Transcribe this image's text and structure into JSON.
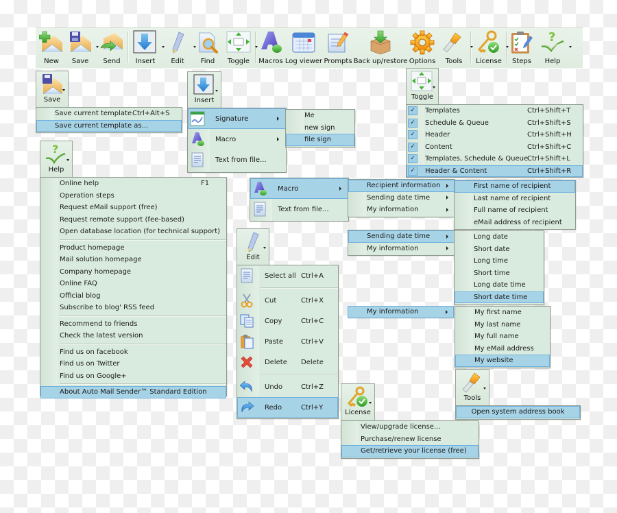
{
  "toolbar": {
    "buttons": [
      {
        "label": "New",
        "icon": "new-mail-icon"
      },
      {
        "label": "Save",
        "icon": "save-mail-icon",
        "dropdown": true
      },
      {
        "label": "Send",
        "icon": "send-mail-icon"
      },
      {
        "label": "Insert",
        "icon": "insert-arrow-icon",
        "dropdown": true
      },
      {
        "label": "Edit",
        "icon": "pencil-icon",
        "dropdown": true
      },
      {
        "label": "Find",
        "icon": "find-magnifier-icon"
      },
      {
        "label": "Toggle",
        "icon": "toggle-arrows-icon",
        "dropdown": true
      },
      {
        "label": "Macros",
        "icon": "macros-icon"
      },
      {
        "label": "Log viewer",
        "icon": "calendar-log-icon"
      },
      {
        "label": "Prompts",
        "icon": "prompts-icon"
      },
      {
        "label": "Back up/restore",
        "icon": "backup-box-icon"
      },
      {
        "label": "Options",
        "icon": "gear-icon"
      },
      {
        "label": "Tools",
        "icon": "screwdriver-icon",
        "dropdown": true
      },
      {
        "label": "License",
        "icon": "license-key-icon",
        "dropdown": true
      },
      {
        "label": "Steps",
        "icon": "clipboard-steps-icon"
      },
      {
        "label": "Help",
        "icon": "help-book-icon",
        "dropdown": true
      }
    ]
  },
  "save_menu": {
    "button_label": "Save",
    "items": [
      {
        "label": "Save current template",
        "shortcut": "Ctrl+Alt+S"
      },
      {
        "label": "Save current template as...",
        "shortcut": "",
        "selected": true
      }
    ]
  },
  "insert_menu": {
    "button_label": "Insert",
    "items": [
      {
        "label": "Signature",
        "submenu": true,
        "selected": true
      },
      {
        "label": "Macro",
        "submenu": true
      },
      {
        "label": "Text from file..."
      }
    ],
    "signature_submenu": [
      {
        "label": "Me"
      },
      {
        "label": "new sign"
      },
      {
        "label": "file sign",
        "selected": true
      }
    ]
  },
  "toggle_menu": {
    "button_label": "Toggle",
    "items": [
      {
        "label": "Templates",
        "shortcut": "Ctrl+Shift+T",
        "checked": true
      },
      {
        "label": "Schedule & Queue",
        "shortcut": "Ctrl+Shift+S",
        "checked": true
      },
      {
        "label": "Header",
        "shortcut": "Ctrl+Shift+H",
        "checked": true
      },
      {
        "label": "Content",
        "shortcut": "Ctrl+Shift+C",
        "checked": true
      },
      {
        "label": "Templates, Schedule & Queue",
        "shortcut": "Ctrl+Shift+L",
        "checked": true
      },
      {
        "label": "Header & Content",
        "shortcut": "Ctrl+Shift+R",
        "checked": true,
        "selected": true
      }
    ]
  },
  "help_menu": {
    "button_label": "Help",
    "groups": [
      [
        {
          "label": "Online help",
          "shortcut": "F1"
        },
        {
          "label": "Operation steps"
        },
        {
          "label": "Request eMail support (free)"
        },
        {
          "label": "Request remote support (fee-based)"
        },
        {
          "label": "Open database location (for technical support)"
        }
      ],
      [
        {
          "label": "Product homepage"
        },
        {
          "label": "Mail solution homepage"
        },
        {
          "label": "Company homepage"
        },
        {
          "label": "Online FAQ"
        },
        {
          "label": "Official blog"
        },
        {
          "label": "Subscribe to blog' RSS feed"
        }
      ],
      [
        {
          "label": "Recommend to friends"
        },
        {
          "label": "Check the latest version"
        }
      ],
      [
        {
          "label": "Find us on facebook"
        },
        {
          "label": "Find us on Twitter"
        },
        {
          "label": "Find us on Google+"
        }
      ],
      [
        {
          "label": "About Auto Mail Sender™ Standard Edition",
          "selected": true
        }
      ]
    ]
  },
  "macro_menu": {
    "items": [
      {
        "label": "Macro",
        "submenu": true,
        "selected": true
      },
      {
        "label": "Text from file..."
      }
    ],
    "macro_submenu": [
      {
        "label": "Recipient information",
        "submenu": true,
        "selected": true
      },
      {
        "label": "Sending date time",
        "submenu": true
      },
      {
        "label": "My information",
        "submenu": true
      }
    ],
    "recipient_submenu": [
      {
        "label": "First name of recipient",
        "selected": true
      },
      {
        "label": "Last name of recipient"
      },
      {
        "label": "Full name of recipient"
      },
      {
        "label": "eMail address of recipient"
      }
    ],
    "macro_submenu_2": [
      {
        "label": "Sending date time",
        "submenu": true,
        "selected": true
      },
      {
        "label": "My information",
        "submenu": true
      }
    ],
    "datetime_submenu": [
      {
        "label": "Long date"
      },
      {
        "label": "Short date"
      },
      {
        "label": "Long time"
      },
      {
        "label": "Short time"
      },
      {
        "label": "Long date time"
      },
      {
        "label": "Short date time",
        "selected": true
      }
    ],
    "macro_submenu_3": [
      {
        "label": "My information",
        "submenu": true,
        "selected": true
      }
    ],
    "myinfo_submenu": [
      {
        "label": "My first name"
      },
      {
        "label": "My last name"
      },
      {
        "label": "My full name"
      },
      {
        "label": "My eMail address"
      },
      {
        "label": "My website",
        "selected": true
      }
    ]
  },
  "edit_menu": {
    "button_label": "Edit",
    "items": [
      {
        "label": "Select all",
        "shortcut": "Ctrl+A",
        "icon": "select-all-icon"
      },
      {
        "label": "Cut",
        "shortcut": "Ctrl+X",
        "icon": "scissors-icon"
      },
      {
        "label": "Copy",
        "shortcut": "Ctrl+C",
        "icon": "copy-icon"
      },
      {
        "label": "Paste",
        "shortcut": "Ctrl+V",
        "icon": "paste-icon"
      },
      {
        "label": "Delete",
        "shortcut": "Delete",
        "icon": "delete-x-icon"
      },
      {
        "label": "Undo",
        "shortcut": "Ctrl+Z",
        "icon": "undo-icon"
      },
      {
        "label": "Redo",
        "shortcut": "Ctrl+Y",
        "icon": "redo-icon",
        "selected": true
      }
    ]
  },
  "tools_menu": {
    "button_label": "Tools",
    "items": [
      {
        "label": "Open system address book",
        "selected": true
      }
    ]
  },
  "license_menu": {
    "button_label": "License",
    "items": [
      {
        "label": "View/upgrade license..."
      },
      {
        "label": "Purchase/renew license"
      },
      {
        "label": "Get/retrieve your license (free)",
        "selected": true
      }
    ]
  },
  "colors": {
    "menu_bg": "#d9ebde",
    "selection": "#a7d3e6",
    "selection_border": "#6fb0df",
    "toolbar_bg": "#e4efe5"
  }
}
